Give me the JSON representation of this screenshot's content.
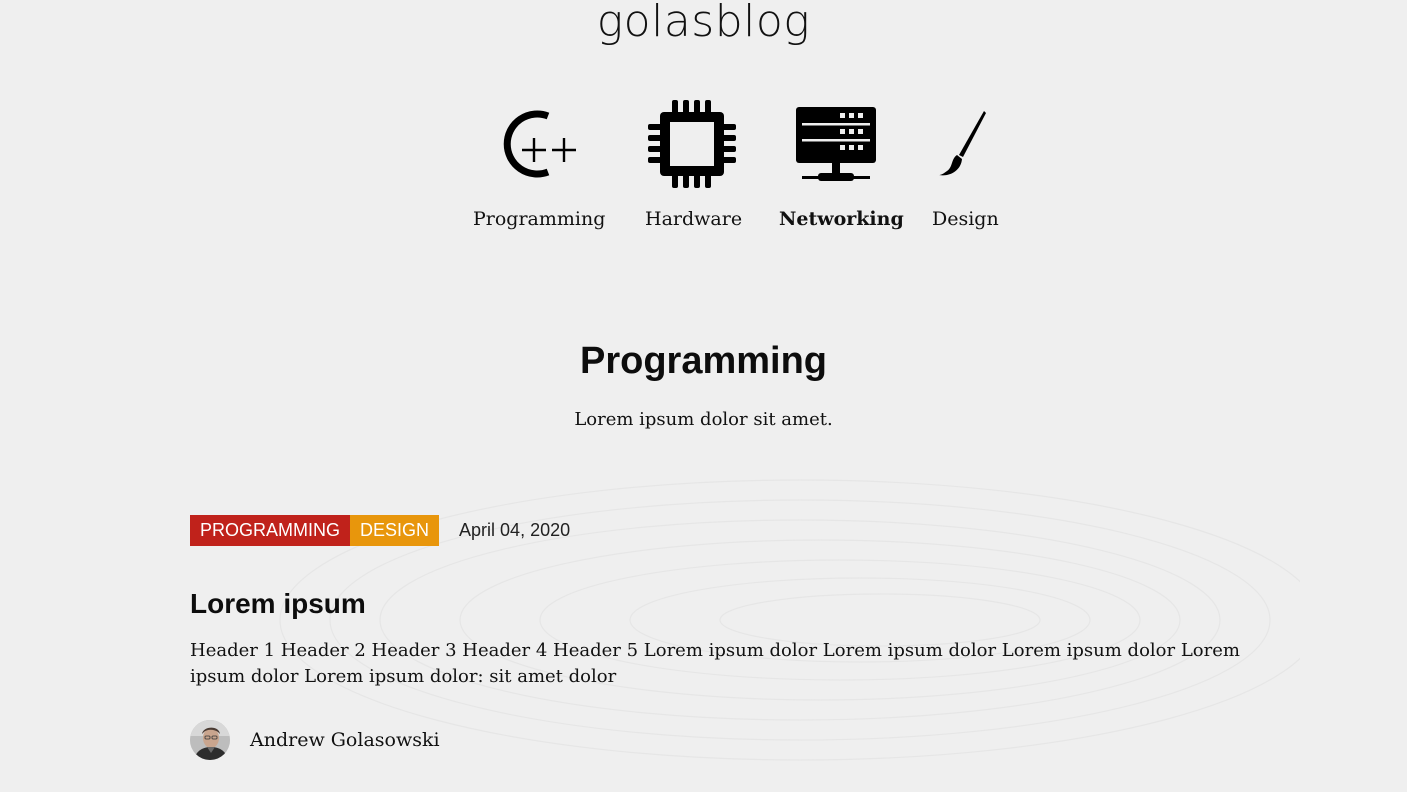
{
  "site": {
    "title": "golasblog"
  },
  "nav": {
    "categories": [
      {
        "label": "Programming",
        "icon": "cplusplus-icon",
        "active": false
      },
      {
        "label": "Hardware",
        "icon": "chip-icon",
        "active": false
      },
      {
        "label": "Networking",
        "icon": "server-icon",
        "active": true
      },
      {
        "label": "Design",
        "icon": "paintbrush-icon",
        "active": false
      }
    ]
  },
  "section": {
    "title": "Programming",
    "description": "Lorem ipsum dolor sit amet."
  },
  "post": {
    "tags": [
      {
        "label": "PROGRAMMING",
        "color": "#c0221b"
      },
      {
        "label": "DESIGN",
        "color": "#e8960c"
      }
    ],
    "date": "April 04, 2020",
    "title": "Lorem ipsum",
    "excerpt": "Header 1 Header 2 Header 3 Header 4 Header 5 Lorem ipsum dolor Lorem ipsum dolor Lorem ipsum dolor Lorem ipsum dolor Lorem ipsum dolor: sit amet dolor",
    "author": {
      "name": "Andrew Golasowski",
      "avatar": "avatar-photo"
    }
  },
  "colors": {
    "background": "#efefef",
    "text": "#111111",
    "tag_programming": "#c0221b",
    "tag_design": "#e8960c"
  }
}
